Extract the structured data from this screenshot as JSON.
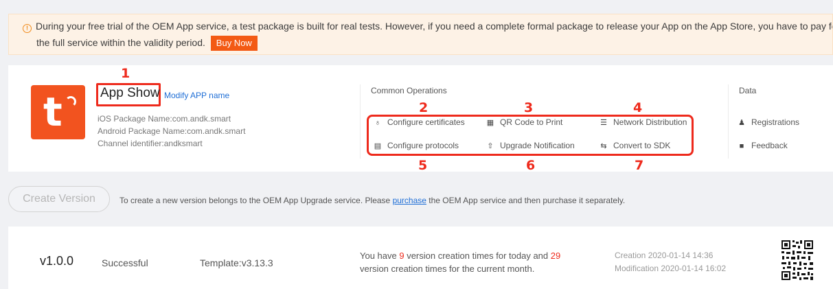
{
  "notice": {
    "line1": "During your free trial of the OEM App service, a test package is built for real tests. However, if you need a complete formal package to release your App on the App Store, you have to pay for",
    "line2": "the full service within the validity period.",
    "buy_label": "Buy Now",
    "icon": "warning-circle-icon"
  },
  "app": {
    "name": "App Show",
    "modify_label": "Modify APP name",
    "ios_package": "iOS Package Name:com.andk.smart",
    "android_package": "Android Package Name:com.andk.smart",
    "channel": "Channel identifier:andksmart"
  },
  "common_operations": {
    "title": "Common Operations",
    "items": [
      {
        "label": "Configure certificates",
        "icon": "certificate-icon"
      },
      {
        "label": "QR Code to Print",
        "icon": "qr-code-icon"
      },
      {
        "label": "Network Distribution",
        "icon": "network-list-icon"
      },
      {
        "label": "Configure protocols",
        "icon": "document-icon"
      },
      {
        "label": "Upgrade Notification",
        "icon": "upgrade-arrow-icon"
      },
      {
        "label": "Convert to SDK",
        "icon": "convert-icon"
      }
    ]
  },
  "data_section": {
    "title": "Data",
    "items": [
      {
        "label": "Registrations",
        "icon": "users-icon"
      },
      {
        "label": "Feedback",
        "icon": "feedback-icon"
      }
    ]
  },
  "annotations": [
    "1",
    "2",
    "3",
    "4",
    "5",
    "6",
    "7"
  ],
  "create": {
    "button_label": "Create Version",
    "hint_before": "To create a new version belongs to the OEM App Upgrade service. Please ",
    "hint_link": "purchase",
    "hint_after": " the OEM App service and then purchase it separately."
  },
  "version": {
    "number": "v1.0.0",
    "status": "Successful",
    "template": "Template:v3.13.3",
    "info_a": "You have ",
    "today_count": "9",
    "info_b": " version creation times for today and ",
    "month_count": "29",
    "info_c": "version creation times for the current month.",
    "creation": "Creation 2020-01-14 14:36",
    "modification": "Modification 2020-01-14 16:02"
  },
  "colors": {
    "accent": "#ee2a1c",
    "brand": "#f2531f",
    "link": "#1e6ed6",
    "buy": "#f35a14",
    "notice_bg": "#fdf2e6"
  }
}
